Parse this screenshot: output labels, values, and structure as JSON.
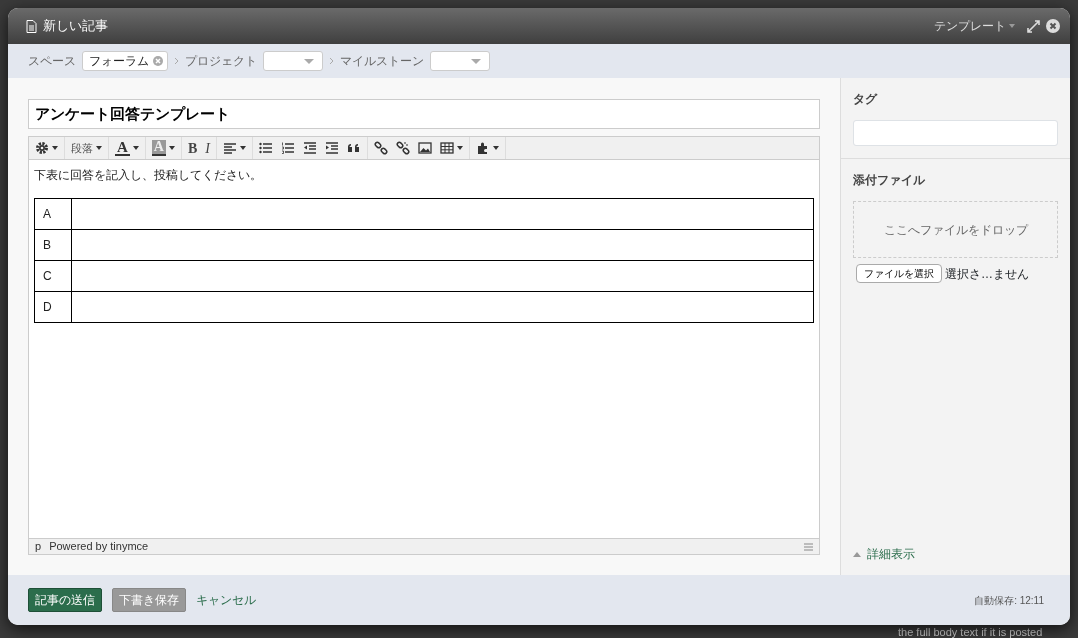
{
  "window": {
    "title": "新しい記事",
    "template_menu": "テンプレート"
  },
  "breadcrumb": [
    {
      "label": "スペース",
      "kind": "tag",
      "value": "フォーラム"
    },
    {
      "label": "プロジェクト",
      "kind": "select"
    },
    {
      "label": "マイルストーン",
      "kind": "select"
    }
  ],
  "title_field": {
    "value": "アンケート回答テンプレート"
  },
  "toolbar": [
    [
      {
        "kind": "settings",
        "dropdown": true
      }
    ],
    [
      {
        "kind": "format",
        "label": "段落",
        "dropdown": true
      }
    ],
    [
      {
        "kind": "forecolor",
        "label": "A",
        "dropdown": true
      }
    ],
    [
      {
        "kind": "backcolor",
        "label": "A",
        "dropdown": true
      }
    ],
    [
      {
        "kind": "bold",
        "label": "B",
        "dropdown": false
      },
      {
        "kind": "italic",
        "label": "I",
        "dropdown": false
      }
    ],
    [
      {
        "kind": "align",
        "dropdown": true
      }
    ],
    [
      {
        "kind": "bullist",
        "dropdown": false
      },
      {
        "kind": "numlist",
        "dropdown": false
      },
      {
        "kind": "outdent",
        "dropdown": false
      },
      {
        "kind": "indent",
        "dropdown": false
      },
      {
        "kind": "quote",
        "dropdown": false
      }
    ],
    [
      {
        "kind": "link",
        "dropdown": false
      },
      {
        "kind": "unlink",
        "dropdown": false
      },
      {
        "kind": "image",
        "dropdown": false
      },
      {
        "kind": "table",
        "dropdown": true
      }
    ],
    [
      {
        "kind": "plugin",
        "dropdown": true
      }
    ]
  ],
  "editor": {
    "intro": "下表に回答を記入し、投稿してください。",
    "rows": [
      {
        "label": "A"
      },
      {
        "label": "B"
      },
      {
        "label": "C"
      },
      {
        "label": "D"
      }
    ]
  },
  "status_bar": {
    "path": "p",
    "credit": "Powered by tinymce"
  },
  "sidebar": {
    "tags_label": "タグ",
    "attachments_label": "添付ファイル",
    "drop_zone": "ここへファイルをドロップ",
    "file_button": "ファイルを選択",
    "file_status": "選択さ…ません",
    "details_link": "詳細表示"
  },
  "footer": {
    "submit": "記事の送信",
    "save_draft": "下書き保存",
    "cancel": "キャンセル",
    "autosave": "自動保存: 12:11"
  },
  "background": {
    "text": "the full body text if it is posted"
  }
}
